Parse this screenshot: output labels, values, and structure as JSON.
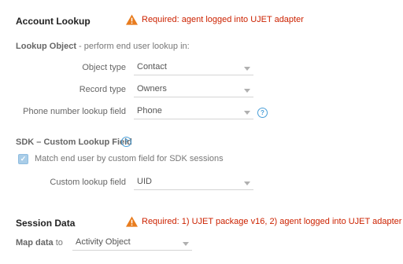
{
  "account_lookup": {
    "title": "Account Lookup",
    "warning": "Required:  agent logged into UJET adapter"
  },
  "lookup_object": {
    "label": "Lookup Object",
    "desc": " - perform end user lookup in:",
    "fields": [
      {
        "label": "Object type",
        "value": "Contact"
      },
      {
        "label": "Record type",
        "value": "Owners"
      },
      {
        "label": "Phone number lookup field",
        "value": "Phone"
      }
    ]
  },
  "sdk": {
    "title": "SDK – Custom Lookup Field",
    "checkbox_label": "Match end user by custom field for SDK sessions",
    "checkbox_checked": true,
    "field": {
      "label": "Custom  lookup field",
      "value": "UID"
    }
  },
  "session_data": {
    "title": "Session Data",
    "warning": "Required: 1) UJET package v16, 2) agent logged into UJET adapter",
    "map_label": "Map data",
    "map_to": " to",
    "map_value": "Activity Object"
  },
  "colors": {
    "warning": "#cc2200",
    "warning_icon": "#e87c1e",
    "help_icon": "#4a9fd8",
    "checkbox": "#a9cde8"
  },
  "icons": {
    "warning": "warning-triangle-icon",
    "help": "help-circle-icon",
    "caret": "chevron-down-icon",
    "check": "checkmark-icon"
  }
}
